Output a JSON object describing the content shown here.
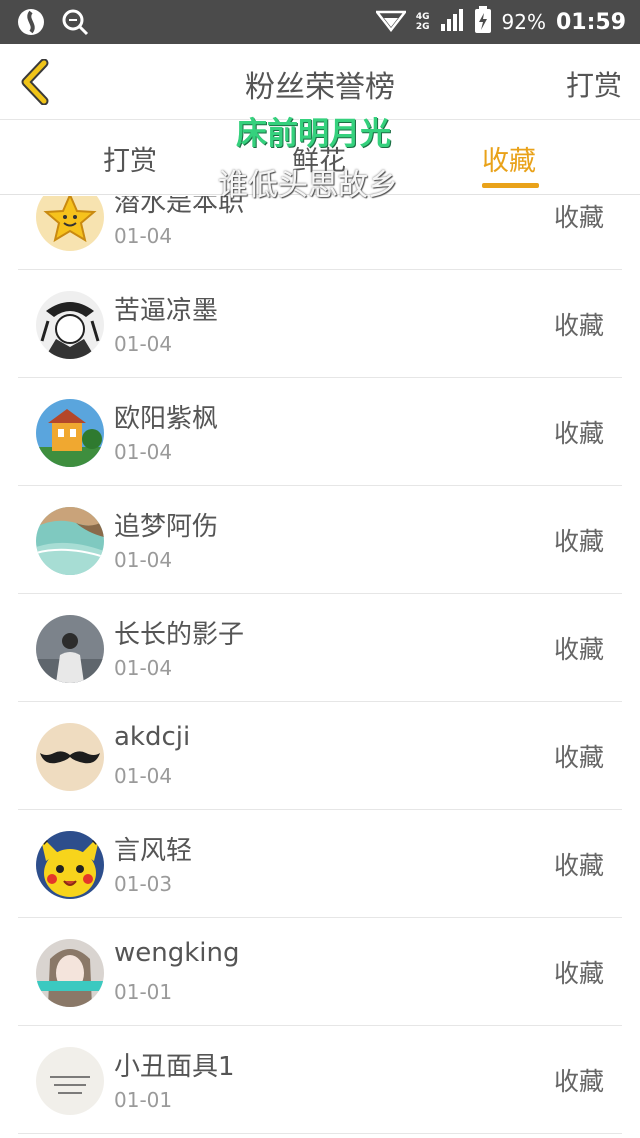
{
  "status_bar": {
    "network_top": "4G",
    "network_bottom": "2G",
    "battery": "92%",
    "time": "01:59",
    "icons": [
      "app-icon",
      "search-icon",
      "wifi-icon",
      "signal-icon",
      "battery-icon"
    ]
  },
  "header": {
    "title": "粉丝荣誉榜",
    "right_action": "打赏",
    "back_icon": "chevron-left-icon"
  },
  "tabs": [
    {
      "label": "打赏",
      "active": false
    },
    {
      "label": "鲜花",
      "active": false
    },
    {
      "label": "收藏",
      "active": true
    }
  ],
  "overlay": {
    "line1": "床前明月光",
    "line2": "谁低头思故乡"
  },
  "colors": {
    "accent": "#e9a21a",
    "status_bar": "#4b4b4b",
    "overlay_green": "#35d17d"
  },
  "list": [
    {
      "name": "潜水是本职",
      "date": "01-04",
      "action": "收藏",
      "avatar": "yellow-star-avatar"
    },
    {
      "name": "苦逼凉墨",
      "date": "01-04",
      "action": "收藏",
      "avatar": "sketch-avatar"
    },
    {
      "name": "欧阳紫枫",
      "date": "01-04",
      "action": "收藏",
      "avatar": "house-avatar"
    },
    {
      "name": "追梦阿伤",
      "date": "01-04",
      "action": "收藏",
      "avatar": "beach-avatar"
    },
    {
      "name": "长长的影子",
      "date": "01-04",
      "action": "收藏",
      "avatar": "person-avatar"
    },
    {
      "name": "akdcji",
      "date": "01-04",
      "action": "收藏",
      "avatar": "mustache-avatar"
    },
    {
      "name": "言风轻",
      "date": "01-03",
      "action": "收藏",
      "avatar": "pikachu-avatar"
    },
    {
      "name": "wengking",
      "date": "01-01",
      "action": "收藏",
      "avatar": "girl-avatar"
    },
    {
      "name": "小丑面具1",
      "date": "01-01",
      "action": "收藏",
      "avatar": "note-avatar"
    }
  ]
}
